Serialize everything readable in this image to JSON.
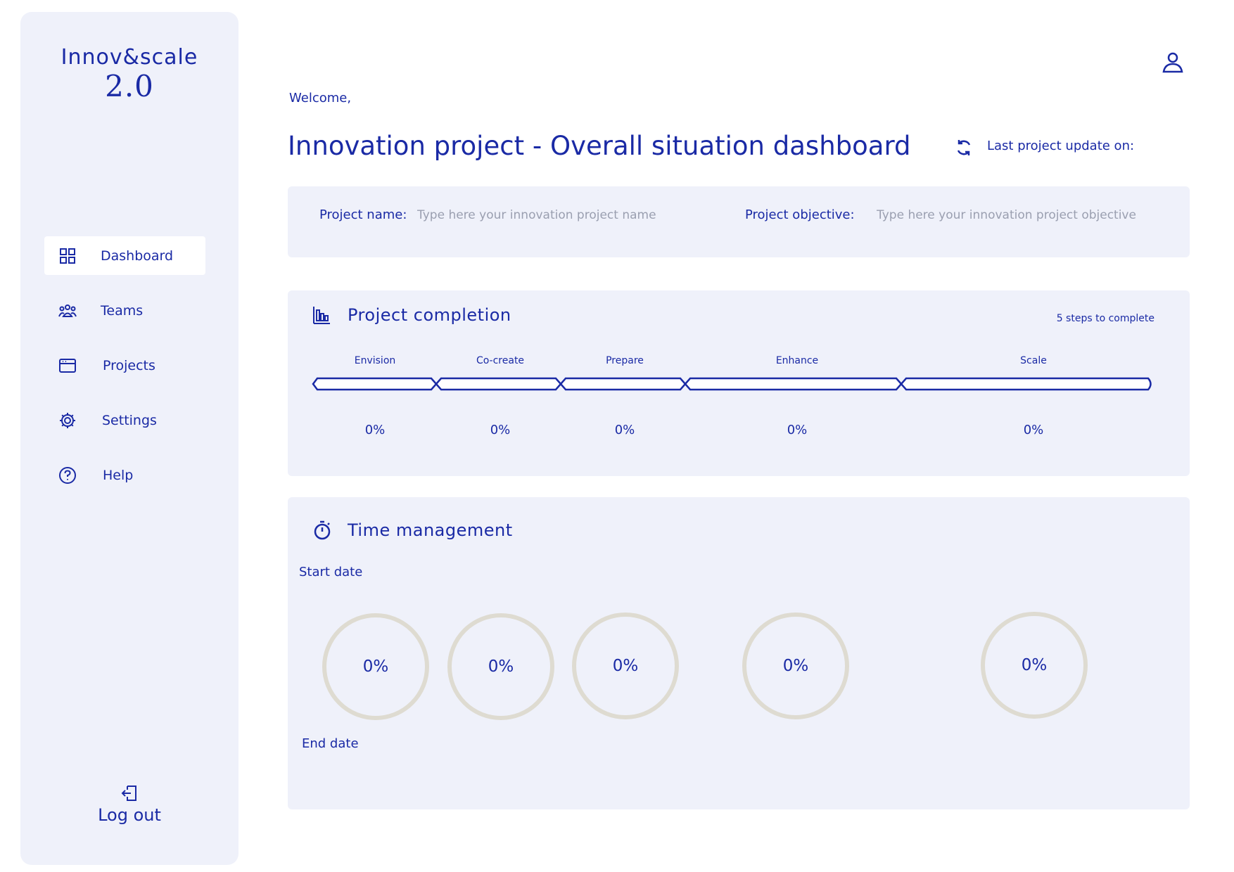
{
  "sidebar": {
    "brand_name": "Innov&scale",
    "brand_version": "2.0",
    "items": [
      {
        "label": "Dashboard",
        "icon": "grid-icon",
        "active": true
      },
      {
        "label": "Teams",
        "icon": "people-icon",
        "active": false
      },
      {
        "label": "Projects",
        "icon": "browser-window-icon",
        "active": false
      },
      {
        "label": "Settings",
        "icon": "gear-icon",
        "active": false
      },
      {
        "label": "Help",
        "icon": "question-circle-icon",
        "active": false
      }
    ],
    "logout_label": "Log out"
  },
  "header": {
    "welcome": "Welcome,",
    "title": "Innovation project - Overall situation dashboard",
    "last_update_label": "Last project update on:"
  },
  "project_info": {
    "name_label": "Project name:",
    "name_value": "",
    "name_placeholder": "Type here your innovation project name",
    "objective_label": "Project objective:",
    "objective_value": "",
    "objective_placeholder": "Type here your innovation project objective"
  },
  "completion": {
    "heading": "Project completion",
    "steps_note": "5 steps to complete",
    "steps": [
      {
        "label": "Envision",
        "percent_text": "0%",
        "progress": 0
      },
      {
        "label": "Co-create",
        "percent_text": "0%",
        "progress": 0
      },
      {
        "label": "Prepare",
        "percent_text": "0%",
        "progress": 0
      },
      {
        "label": "Enhance",
        "percent_text": "0%",
        "progress": 0
      },
      {
        "label": "Scale",
        "percent_text": "0%",
        "progress": 0
      }
    ]
  },
  "time_management": {
    "heading": "Time management",
    "start_label": "Start date",
    "end_label": "End date",
    "rings": [
      {
        "percent_text": "0%",
        "progress": 0
      },
      {
        "percent_text": "0%",
        "progress": 0
      },
      {
        "percent_text": "0%",
        "progress": 0
      },
      {
        "percent_text": "0%",
        "progress": 0
      },
      {
        "percent_text": "0%",
        "progress": 0
      }
    ]
  },
  "colors": {
    "accent": "#1a2aa5",
    "panel_bg": "#eff1fa",
    "ring_track": "#dedbd1",
    "placeholder": "#9a9fb0"
  }
}
